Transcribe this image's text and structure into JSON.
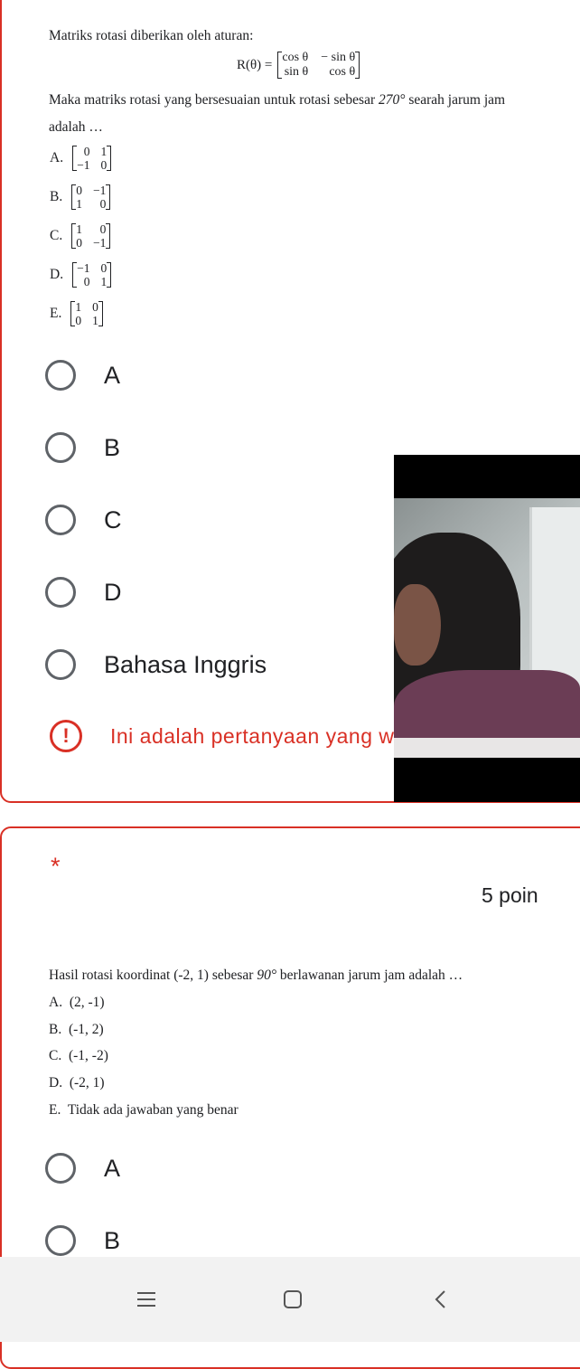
{
  "q1": {
    "intro": "Matriks rotasi diberikan oleh aturan:",
    "formula_lhs": "R(θ) =",
    "formula_matrix": [
      "cos θ",
      "− sin θ",
      "sin θ",
      "cos θ"
    ],
    "prompt_line1_before": "Maka matriks rotasi yang bersesuaian untuk rotasi sebesar",
    "prompt_angle": "270°",
    "prompt_line1_after": "searah jarum jam",
    "prompt_line2": "adalah …",
    "options": [
      {
        "letter": "A.",
        "m": [
          "0",
          "1",
          "−1",
          "0"
        ]
      },
      {
        "letter": "B.",
        "m": [
          "0",
          "−1",
          "1",
          "0"
        ]
      },
      {
        "letter": "C.",
        "m": [
          "1",
          "0",
          "0",
          "−1"
        ]
      },
      {
        "letter": "D.",
        "m": [
          "−1",
          "0",
          "0",
          "1"
        ]
      },
      {
        "letter": "E.",
        "m": [
          "1",
          "0",
          "0",
          "1"
        ]
      }
    ],
    "choices": [
      "A",
      "B",
      "C",
      "D",
      "Bahasa Inggris"
    ],
    "error_text": "Ini adalah pertanyaan yang wajib diisi"
  },
  "q2": {
    "required_mark": "*",
    "points": "5 poin",
    "prompt_before": "Hasil rotasi koordinat",
    "prompt_coord": "(-2, 1)",
    "prompt_mid": "sebesar",
    "prompt_angle": "90°",
    "prompt_after": "berlawanan jarum jam adalah …",
    "options": [
      {
        "letter": "A.",
        "text": "(2, -1)"
      },
      {
        "letter": "B.",
        "text": "(-1, 2)"
      },
      {
        "letter": "C.",
        "text": "(-1, -2)"
      },
      {
        "letter": "D.",
        "text": "(-2, 1)"
      },
      {
        "letter": "E.",
        "text": "Tidak ada jawaban yang benar"
      }
    ],
    "choices": [
      "A",
      "B"
    ]
  },
  "colors": {
    "accent_error": "#d93025",
    "radio_border": "#5f6368",
    "text": "#202124",
    "navbar": "#f2f2f2"
  },
  "navbar": {
    "icons": [
      "menu-icon",
      "home-square-icon",
      "back-chevron-icon"
    ]
  }
}
